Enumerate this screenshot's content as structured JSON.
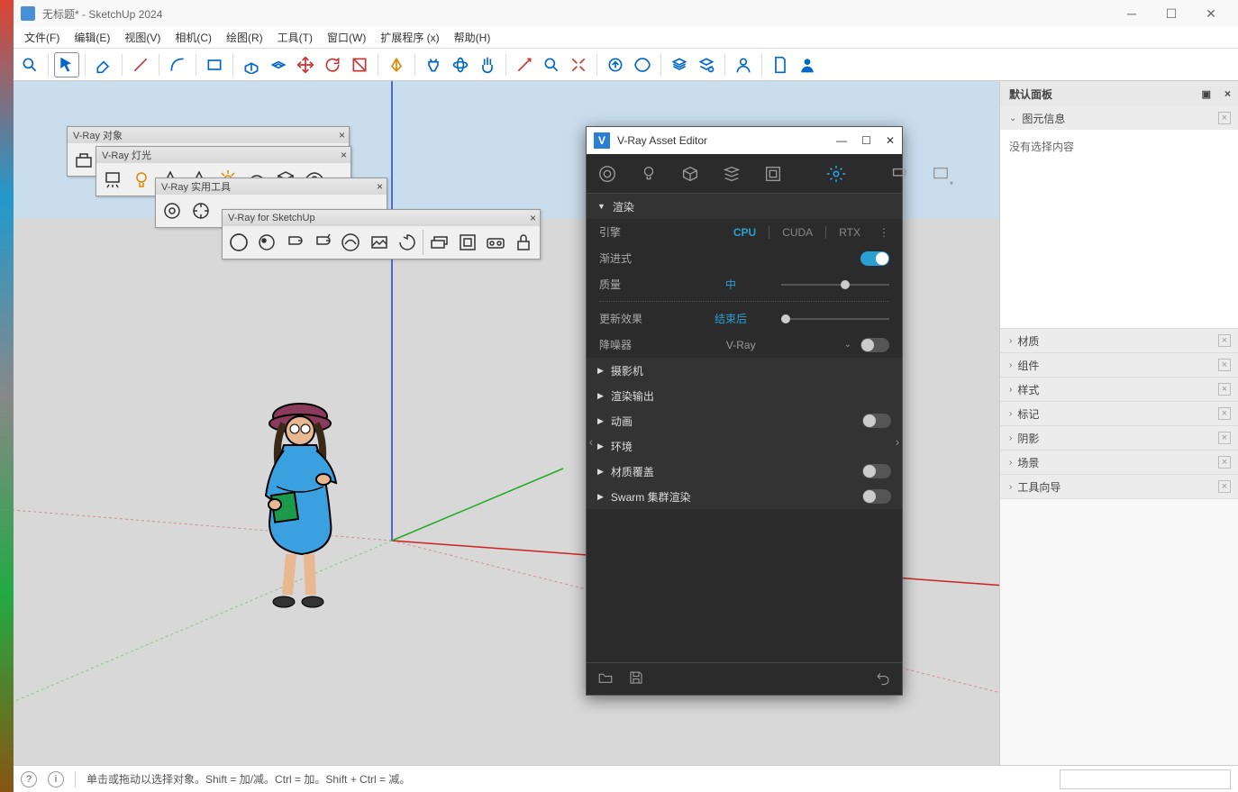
{
  "title": "无标题* - SketchUp 2024",
  "menu": [
    "文件(F)",
    "编辑(E)",
    "视图(V)",
    "相机(C)",
    "绘图(R)",
    "工具(T)",
    "窗口(W)",
    "扩展程序 (x)",
    "帮助(H)"
  ],
  "status": {
    "hint": "单击或拖动以选择对象。Shift = 加/减。Ctrl = 加。Shift + Ctrl = 减。"
  },
  "rightpanel": {
    "title": "默认面板",
    "entity": {
      "title": "图元信息",
      "empty": "没有选择内容"
    },
    "sections": [
      "材质",
      "组件",
      "样式",
      "标记",
      "阴影",
      "场景",
      "工具向导"
    ]
  },
  "floatbars": {
    "vrayObjects": "V-Ray 对象",
    "vrayLights": "V-Ray 灯光",
    "vrayUtils": "V-Ray 实用工具",
    "vraySketchup": "V-Ray for SketchUp"
  },
  "vray": {
    "title": "V-Ray Asset Editor",
    "render": "渲染",
    "engine": {
      "label": "引擎",
      "options": [
        "CPU",
        "CUDA",
        "RTX"
      ],
      "active": "CPU"
    },
    "progressive": "渐进式",
    "quality": {
      "label": "质量",
      "value": "中"
    },
    "update": {
      "label": "更新效果",
      "value": "结束后"
    },
    "denoiser": {
      "label": "降噪器",
      "value": "V-Ray"
    },
    "sections": [
      {
        "name": "摄影机",
        "toggle": null
      },
      {
        "name": "渲染输出",
        "toggle": null
      },
      {
        "name": "动画",
        "toggle": false
      },
      {
        "name": "环境",
        "toggle": null
      },
      {
        "name": "材质覆盖",
        "toggle": false
      },
      {
        "name": "Swarm 集群渲染",
        "toggle": false
      }
    ]
  }
}
